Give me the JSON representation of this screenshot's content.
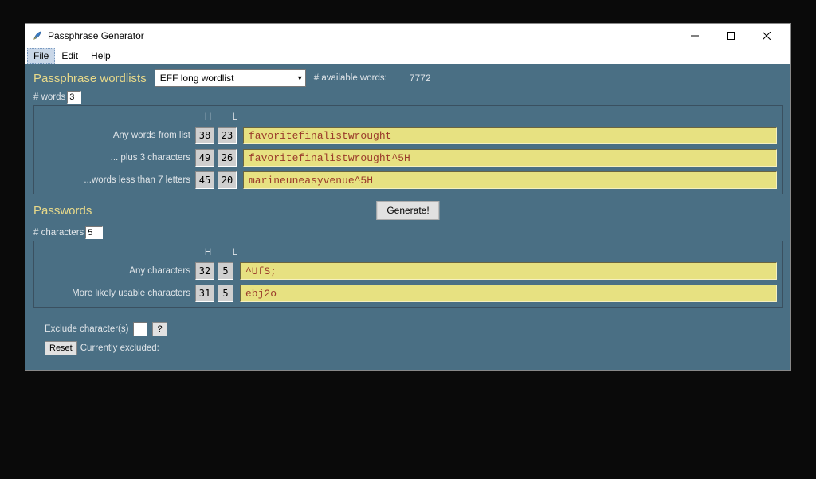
{
  "window": {
    "title": "Passphrase Generator"
  },
  "menu": {
    "file": "File",
    "edit": "Edit",
    "help": "Help"
  },
  "labels": {
    "wordlists": "Passphrase wordlists",
    "available": "# available words:",
    "nwords": "# words",
    "H": "H",
    "L": "L",
    "any_words": "Any words from list",
    "plus3": "... plus 3 characters",
    "less7": "...words less than 7 letters",
    "passwords": "Passwords",
    "generate": "Generate!",
    "nchars": "# characters",
    "anychars": "Any characters",
    "usable": "More likely usable characters",
    "exclude": "Exclude character(s)",
    "q": "?",
    "reset": "Reset",
    "cur_excluded": "Currently excluded:"
  },
  "dropdown": {
    "value": "EFF long wordlist"
  },
  "values": {
    "available_words": "7772",
    "nwords": "3",
    "nchars": "5"
  },
  "phrases": {
    "r1": {
      "h": "38",
      "l": "23",
      "text": "favoritefinalistwrought"
    },
    "r2": {
      "h": "49",
      "l": "26",
      "text": "favoritefinalistwrought^5H"
    },
    "r3": {
      "h": "45",
      "l": "20",
      "text": "marineuneasyvenue^5H"
    }
  },
  "passwords": {
    "r1": {
      "h": "32",
      "l": "5",
      "text": "^UfS;"
    },
    "r2": {
      "h": "31",
      "l": "5",
      "text": "ebj2o"
    }
  }
}
